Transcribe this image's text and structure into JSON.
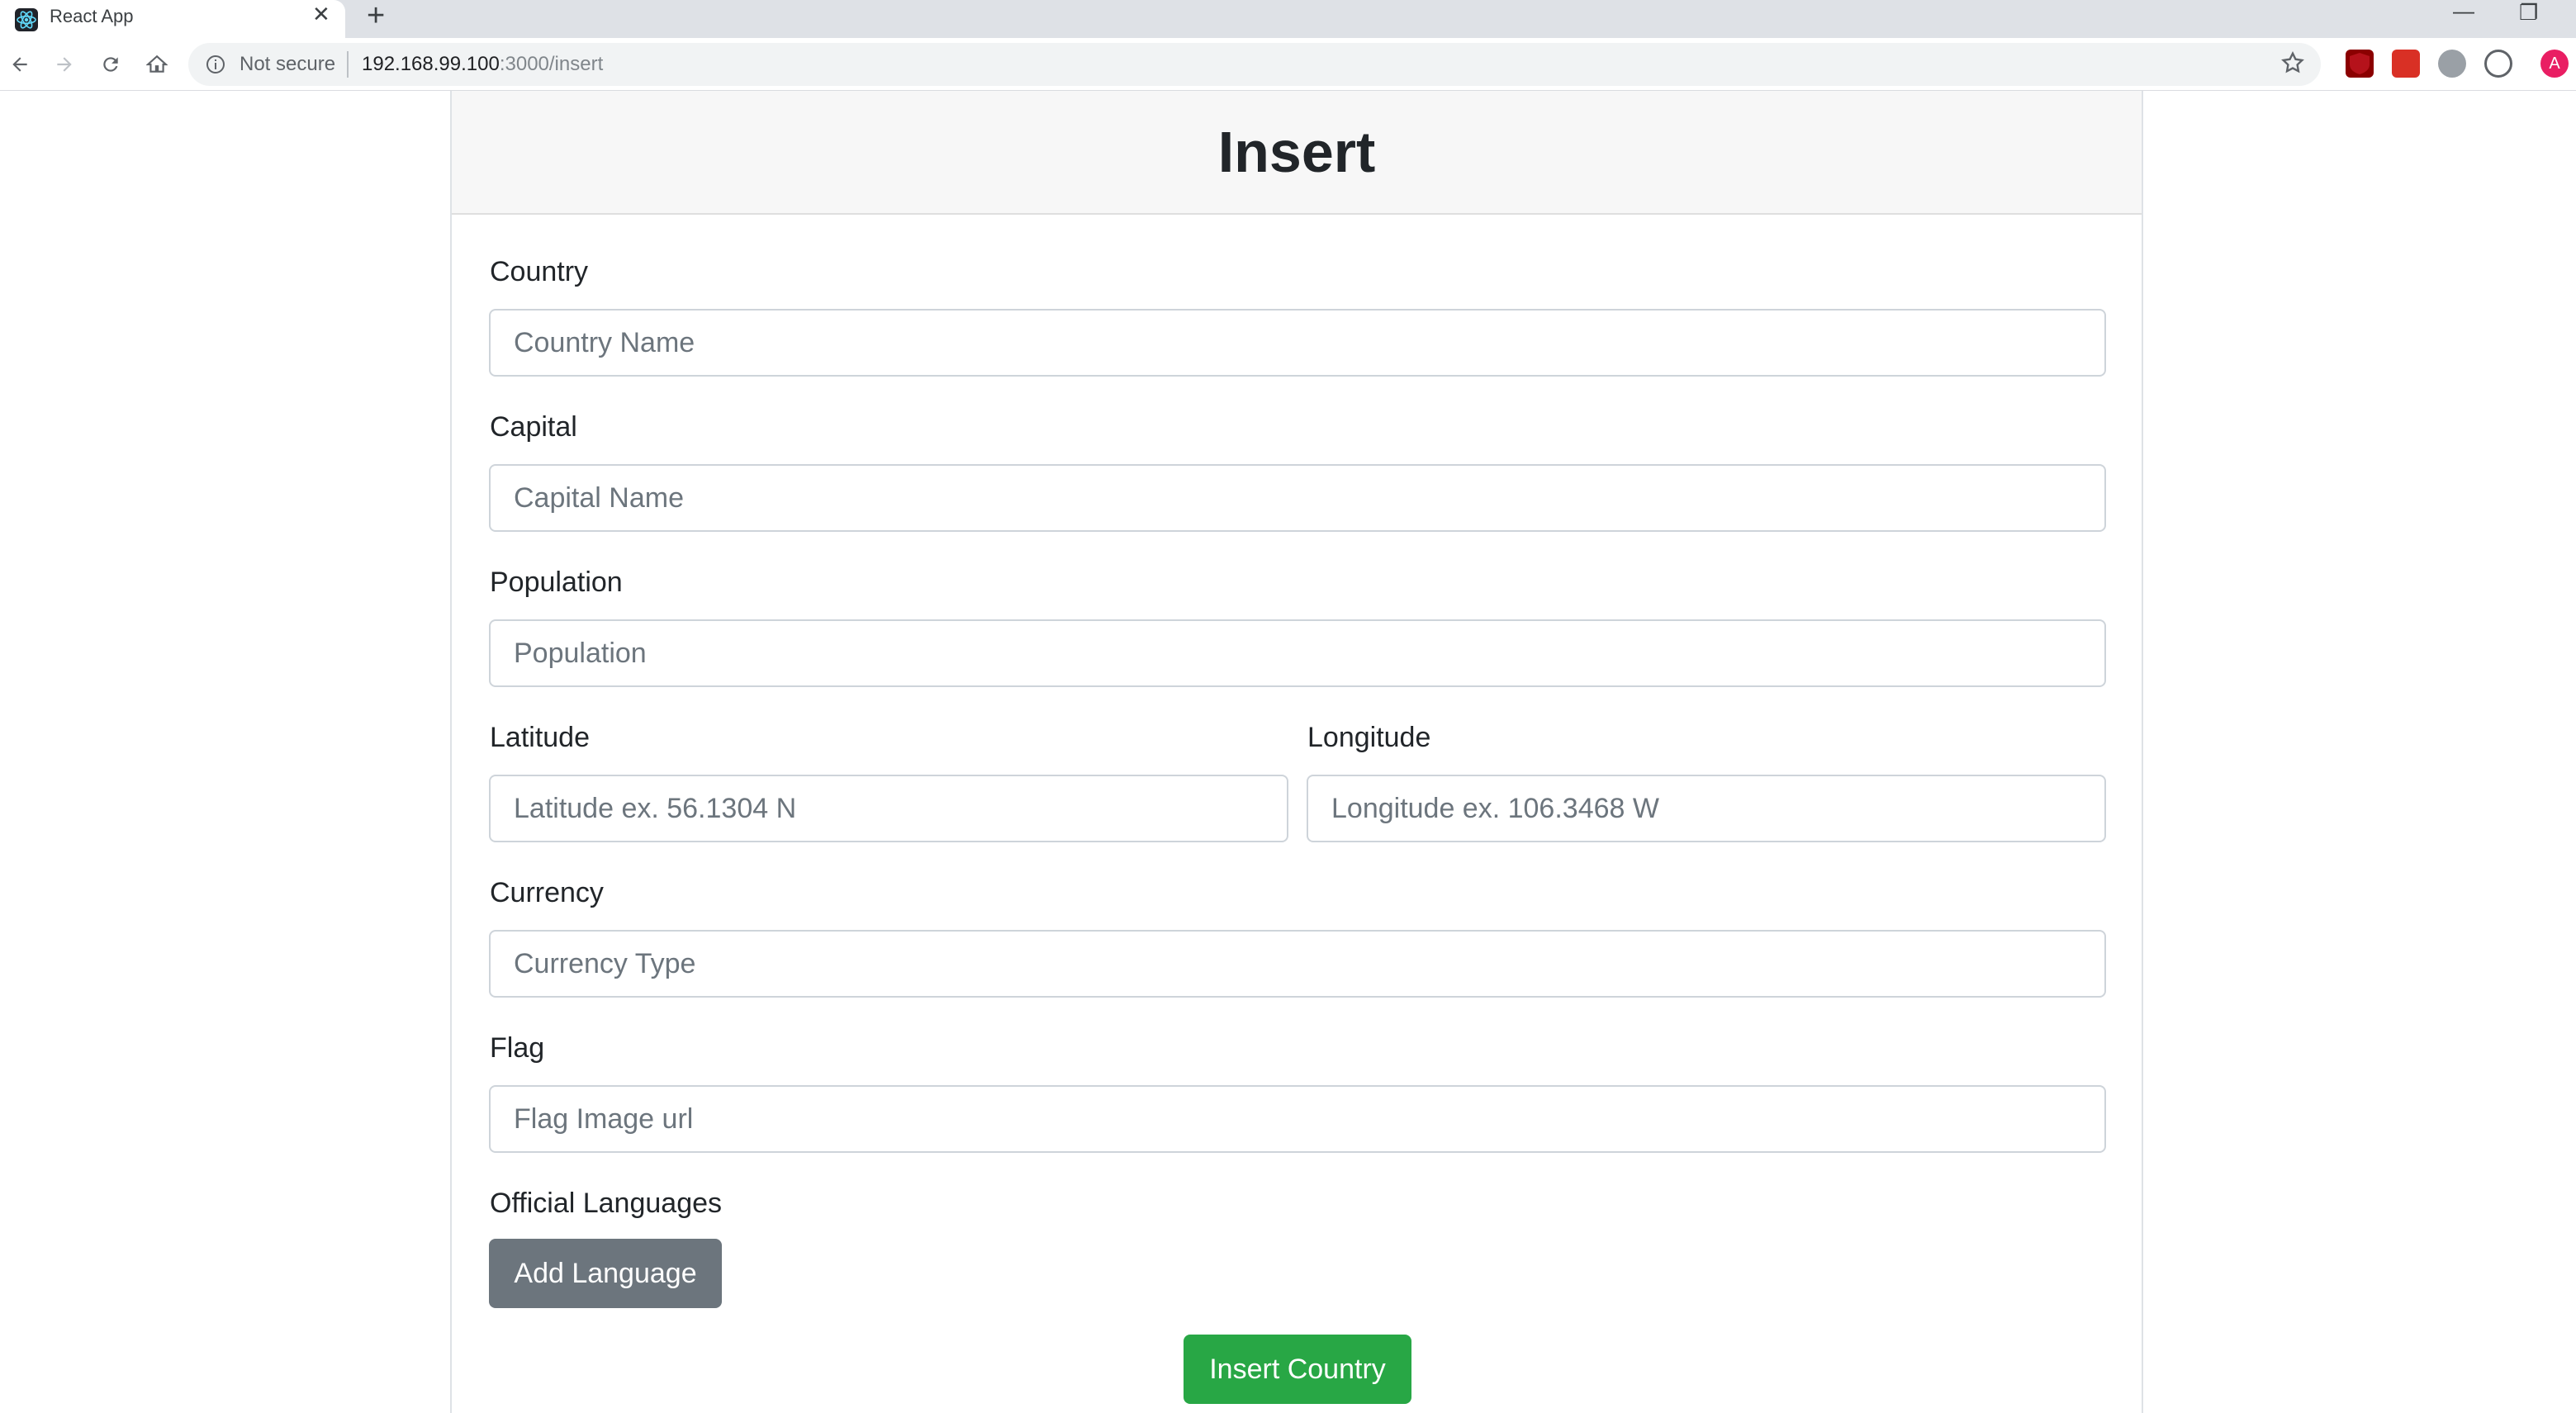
{
  "browser": {
    "tab_title": "React App",
    "tab_close": "✕",
    "new_tab": "+",
    "minimize": "—",
    "restore": "❐",
    "security_label": "Not secure",
    "url_host": "192.168.99.100",
    "url_rest": ":3000/insert",
    "profile_initial": "A",
    "icons": [
      "back-icon",
      "forward-icon",
      "reload-icon",
      "home-icon",
      "info-icon",
      "star-icon"
    ]
  },
  "page": {
    "title": "Insert",
    "fields": {
      "country": {
        "label": "Country",
        "placeholder": "Country Name",
        "value": ""
      },
      "capital": {
        "label": "Capital",
        "placeholder": "Capital Name",
        "value": ""
      },
      "population": {
        "label": "Population",
        "placeholder": "Population",
        "value": ""
      },
      "latitude": {
        "label": "Latitude",
        "placeholder": "Latitude ex. 56.1304 N",
        "value": ""
      },
      "longitude": {
        "label": "Longitude",
        "placeholder": "Longitude ex. 106.3468 W",
        "value": ""
      },
      "currency": {
        "label": "Currency",
        "placeholder": "Currency Type",
        "value": ""
      },
      "flag": {
        "label": "Flag",
        "placeholder": "Flag Image url",
        "value": ""
      }
    },
    "languages_label": "Official Languages",
    "add_language_button": "Add Language",
    "submit_button": "Insert Country"
  },
  "colors": {
    "secondary": "#6c757d",
    "success": "#28a745",
    "header_bg": "#f7f7f7"
  }
}
